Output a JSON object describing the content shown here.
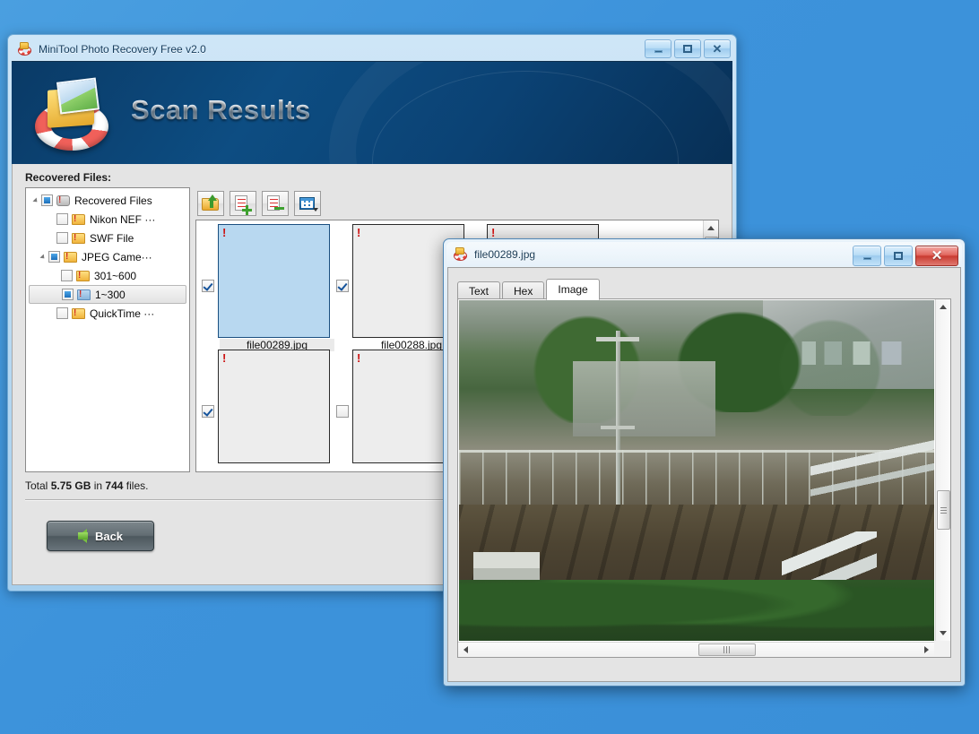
{
  "desktop": {
    "background_color": "#3d93db"
  },
  "main_window": {
    "title": "MiniTool Photo Recovery Free v2.0",
    "icon": "lifebuoy-icon",
    "controls": {
      "minimize": "–",
      "maximize": "□",
      "close": "✕"
    },
    "banner": {
      "heading": "Scan Results",
      "logo": "lifebuoy-folder-photo-logo"
    },
    "section_label": "Recovered Files:",
    "tree": {
      "items": [
        {
          "label": "Recovered Files",
          "indent": 0,
          "expanded": true,
          "checkbox": "filled",
          "icon": "camera-icon",
          "selected": false
        },
        {
          "label": "Nikon NEF ···",
          "indent": 1,
          "expanded": null,
          "checkbox": "empty",
          "icon": "folder-warning-icon",
          "selected": false
        },
        {
          "label": "SWF File",
          "indent": 1,
          "expanded": null,
          "checkbox": "empty",
          "icon": "folder-warning-icon",
          "selected": false
        },
        {
          "label": "JPEG Came···",
          "indent": 1,
          "expanded": true,
          "checkbox": "filled",
          "icon": "folder-warning-icon",
          "selected": false
        },
        {
          "label": "301~600",
          "indent": 2,
          "expanded": null,
          "checkbox": "empty",
          "icon": "folder-warning-icon",
          "selected": false
        },
        {
          "label": "1~300",
          "indent": 2,
          "expanded": null,
          "checkbox": "filled",
          "icon": "folder-blue-warning-icon",
          "selected": true
        },
        {
          "label": "QuickTime ···",
          "indent": 1,
          "expanded": null,
          "checkbox": "empty",
          "icon": "folder-warning-icon",
          "selected": false
        }
      ]
    },
    "toolbar": {
      "buttons": [
        {
          "name": "recover-folder-button",
          "icon": "folder-green-arrow-icon",
          "has_caret": false
        },
        {
          "name": "select-all-button",
          "icon": "document-plus-icon",
          "has_caret": false
        },
        {
          "name": "deselect-all-button",
          "icon": "document-minus-icon",
          "has_caret": false
        },
        {
          "name": "view-mode-button",
          "icon": "grid-view-icon",
          "has_caret": true
        }
      ]
    },
    "thumbnails": [
      {
        "filename": "file00289.jpg",
        "checked": true,
        "selected": true,
        "warning": true,
        "image": "img-hills"
      },
      {
        "filename": "file00288.jpg",
        "checked": true,
        "selected": false,
        "warning": true,
        "image": "img-hills2"
      },
      {
        "filename": "",
        "checked": false,
        "selected": false,
        "warning": true,
        "image": "img-rot"
      },
      {
        "filename": "",
        "checked": true,
        "selected": false,
        "warning": true,
        "image": "img-rot"
      },
      {
        "filename": "",
        "checked": false,
        "selected": false,
        "warning": true,
        "image": "img-gray"
      }
    ],
    "status": {
      "prefix": "Total ",
      "size": "5.75 GB",
      "middle": " in ",
      "count": "744",
      "suffix": " files."
    },
    "back_button": {
      "label": "Back",
      "icon": "left-arrow-icon"
    }
  },
  "preview_window": {
    "title": "file00289.jpg",
    "icon": "lifebuoy-icon",
    "controls": {
      "minimize": "–",
      "maximize": "□",
      "close": "✕"
    },
    "tabs": [
      {
        "label": "Text",
        "active": false
      },
      {
        "label": "Hex",
        "active": false
      },
      {
        "label": "Image",
        "active": true
      }
    ],
    "image_alt": "photo of hillside with fence, utility pole, dirt embankment and roadway"
  }
}
